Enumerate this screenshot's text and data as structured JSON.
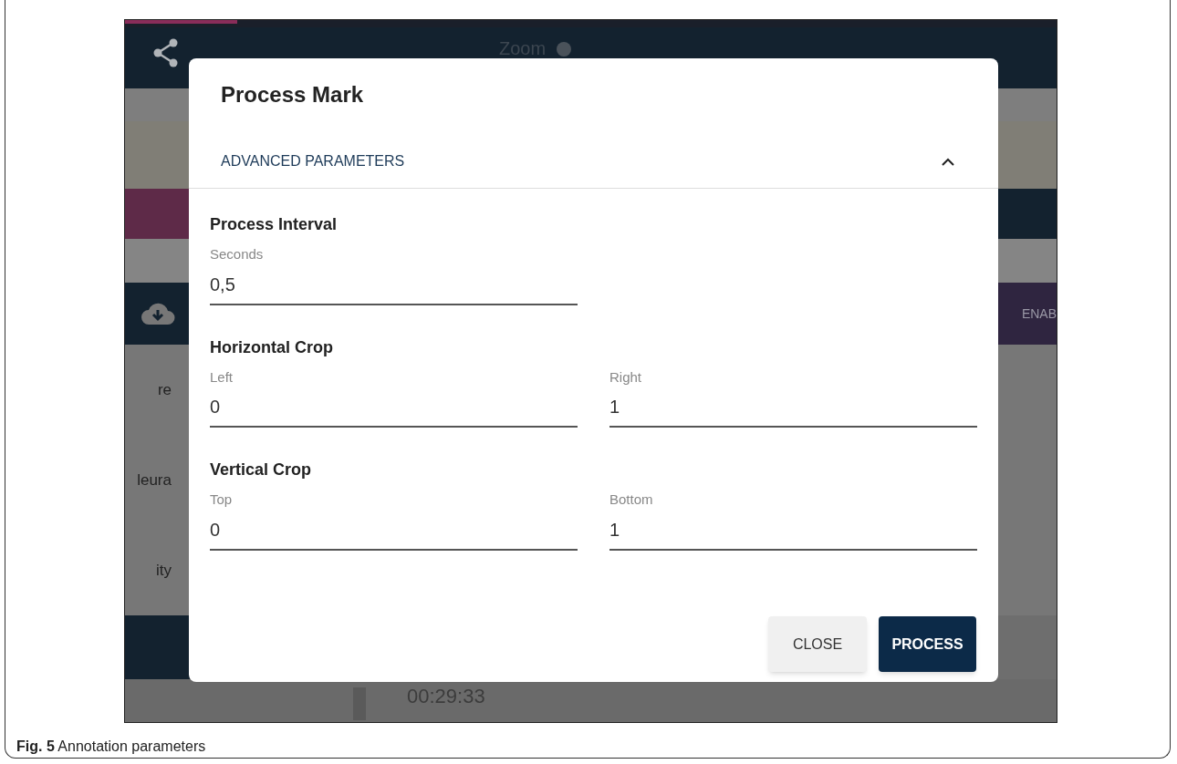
{
  "background": {
    "progress": {
      "level": 0.12
    },
    "zoom_label": "Zoom",
    "side_labels": [
      "re",
      "leura",
      "ity"
    ],
    "enable_button": "ENAB",
    "timestamp": "00:29:33"
  },
  "dialog": {
    "title": "Process Mark",
    "section": {
      "label": "ADVANCED PARAMETERS",
      "expanded": true
    },
    "groups": [
      {
        "title": "Process Interval",
        "fields": [
          {
            "label": "Seconds",
            "value": "0,5"
          }
        ]
      },
      {
        "title": "Horizontal Crop",
        "fields": [
          {
            "label": "Left",
            "value": "0"
          },
          {
            "label": "Right",
            "value": "1"
          }
        ]
      },
      {
        "title": "Vertical Crop",
        "fields": [
          {
            "label": "Top",
            "value": "0"
          },
          {
            "label": "Bottom",
            "value": "1"
          }
        ]
      }
    ],
    "buttons": [
      {
        "label": "CLOSE",
        "kind": "secondary"
      },
      {
        "label": "PROCESS",
        "kind": "primary"
      }
    ]
  },
  "caption": {
    "label": "Fig. 5",
    "text": "Annotation parameters"
  }
}
